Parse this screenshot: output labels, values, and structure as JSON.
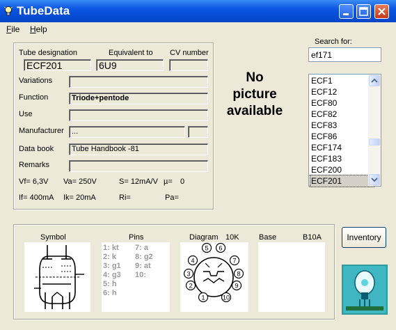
{
  "window": {
    "title": "TubeData"
  },
  "menu": {
    "items": [
      "File",
      "Help"
    ]
  },
  "search": {
    "label": "Search for:",
    "value": "ef171"
  },
  "tube_list": {
    "items": [
      "ECF1",
      "ECF12",
      "ECF80",
      "ECF82",
      "ECF83",
      "ECF86",
      "ECF174",
      "ECF183",
      "ECF200",
      "ECF201"
    ],
    "selected": "ECF201"
  },
  "headers": {
    "designation": "Tube designation",
    "equivalent": "Equivalent to",
    "cv": "CV number"
  },
  "tube": {
    "designation": "ECF201",
    "equivalent": "6U9",
    "cv": "",
    "variations": "",
    "function": "Triode+pentode",
    "use": "",
    "manufacturer": "...",
    "manufacturer_extra": "",
    "data_book": "Tube Handbook -81",
    "remarks": ""
  },
  "labels": {
    "variations": "Variations",
    "function": "Function",
    "use": "Use",
    "manufacturer": "Manufacturer",
    "data_book": "Data book",
    "remarks": "Remarks"
  },
  "specs": {
    "vf": "Vf= 6,3V",
    "va": "Va= 250V",
    "s": "S= 12mA/V",
    "mu": "µ=",
    "mu_val": "0",
    "if": "If= 400mA",
    "ik": "Ik= 20mA",
    "ri": "Ri=",
    "pa": "Pa="
  },
  "no_picture": {
    "line1": "No",
    "line2": "picture",
    "line3": "available"
  },
  "bottom": {
    "symbol": "Symbol",
    "pins": "Pins",
    "diagram": "Diagram",
    "diagram_code": "10K",
    "base": "Base",
    "base_code": "B10A"
  },
  "pins": {
    "left": [
      "1: kt",
      "2: k",
      "3: g1",
      "4: g3",
      "5: h",
      "6: h"
    ],
    "right": [
      "7: a",
      "8: g2",
      "9: at",
      "10:"
    ]
  },
  "diagram_numbers": [
    "1",
    "2",
    "3",
    "4",
    "5",
    "6",
    "7",
    "8",
    "9",
    "10"
  ],
  "buttons": {
    "inventory": "Inventory"
  },
  "icons": {
    "app": "lightbulb-icon",
    "minimize": "minimize-icon",
    "maximize": "maximize-icon",
    "close": "close-icon",
    "logo": "tube-logo-icon"
  }
}
